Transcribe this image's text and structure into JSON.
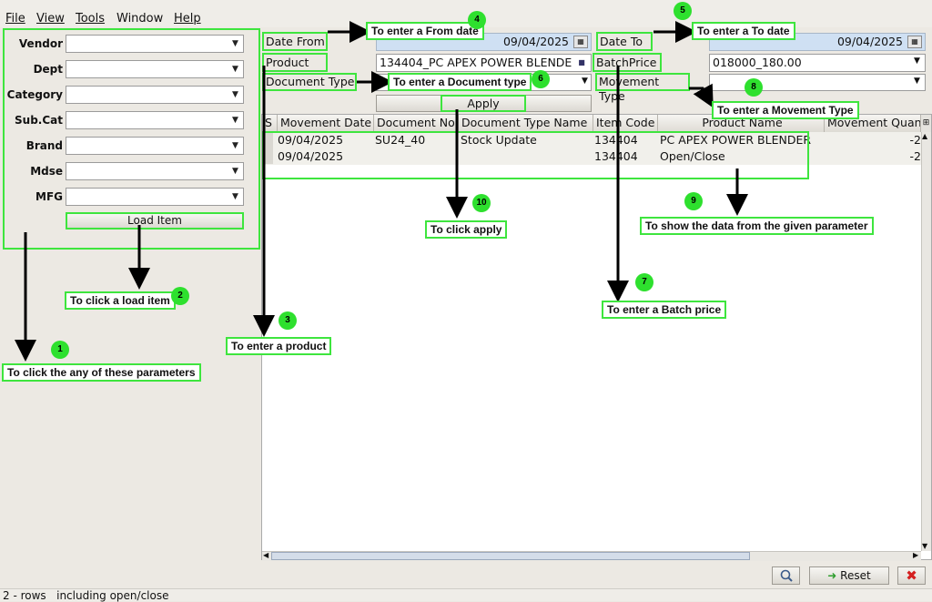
{
  "menu": [
    "File",
    "View",
    "Tools",
    "Window",
    "Help"
  ],
  "filters": {
    "vendor": "Vendor",
    "dept": "Dept",
    "category": "Category",
    "subcat": "Sub.Cat",
    "brand": "Brand",
    "mdse": "Mdse",
    "mfg": "MFG",
    "load_button": "Load Item"
  },
  "params": {
    "date_from_label": "Date From",
    "date_from_value": "09/04/2025",
    "date_to_label": "Date To",
    "date_to_value": "09/04/2025",
    "product_label": "Product",
    "product_value": "134404_PC APEX POWER BLENDE",
    "batchprice_label": "BatchPrice",
    "batchprice_value": "018000_180.00",
    "doctype_label": "Document Type",
    "movtype_label": "Movement Type",
    "apply_button": "Apply"
  },
  "table": {
    "headers": [
      "S",
      "Movement Date",
      "Document No",
      "Document Type Name",
      "Item Code",
      "Product Name",
      "Movement Quan"
    ],
    "rows": [
      [
        "09/04/2025",
        "SU24_40",
        "Stock Update",
        "134404",
        "PC APEX POWER BLENDER",
        "-2"
      ],
      [
        "09/04/2025",
        "",
        "",
        "134404",
        "Open/Close",
        "-2"
      ]
    ]
  },
  "bottom": {
    "reset_button": "Reset",
    "status": "2 - rows   including open/close"
  },
  "callouts": {
    "c1": "To click the any of these parameters",
    "c2": "To click a load item",
    "c3": "To enter a product",
    "c4": "To enter a From date",
    "c5": "To enter a To date",
    "c6": "To enter a Document type",
    "c7": "To enter a Batch price",
    "c8": "To enter a Movement Type",
    "c9": "To show  the data from the given parameter",
    "c10": "To click apply"
  },
  "numbers": {
    "n1": "1",
    "n2": "2",
    "n3": "3",
    "n4": "4",
    "n5": "5",
    "n6": "6",
    "n7": "7",
    "n8": "8",
    "n9": "9",
    "n10": "10"
  },
  "colors": {
    "highlight": "#3ee53e",
    "badge": "#2ee02e",
    "date_field": "#cfe0f3",
    "reset_icon": "#2d9d2d",
    "close_icon": "#d42020"
  }
}
